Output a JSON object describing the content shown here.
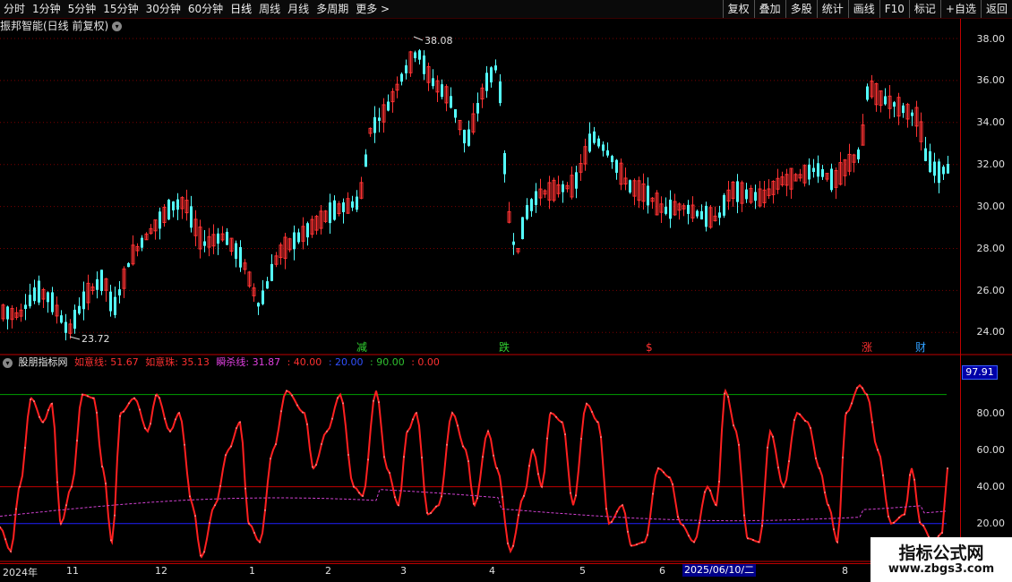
{
  "toolbar": {
    "left": [
      "分时",
      "1分钟",
      "5分钟",
      "15分钟",
      "30分钟",
      "60分钟",
      "日线",
      "周线",
      "月线",
      "多周期",
      "更多 >"
    ],
    "right": [
      "复权",
      "叠加",
      "多股",
      "统计",
      "画线",
      "F10",
      "标记",
      "+自选",
      "返回"
    ]
  },
  "chart_title": "振邦智能(日线 前复权)",
  "price_axis": [
    "38.00",
    "36.00",
    "34.00",
    "32.00",
    "30.00",
    "28.00",
    "26.00",
    "24.00"
  ],
  "high_label": "38.08",
  "low_label": "23.72",
  "markers": [
    "减",
    "跌",
    "$",
    "涨",
    "财"
  ],
  "indicator": {
    "name": "股朋指标网",
    "items": [
      {
        "text": "如意线: 51.67",
        "color": "#ff3030"
      },
      {
        "text": "如意珠: 35.13",
        "color": "#ff3030"
      },
      {
        "text": "瞬杀线: 31.87",
        "color": "#e040e0"
      },
      {
        "text": ": 40.00",
        "color": "#ff3030"
      },
      {
        "text": ": 20.00",
        "color": "#3050ff"
      },
      {
        "text": ": 90.00",
        "color": "#30c030"
      },
      {
        "text": ": 0.00",
        "color": "#ff3030"
      }
    ],
    "current_value": "97.91",
    "axis": [
      "80.00",
      "60.00",
      "40.00",
      "20.00"
    ]
  },
  "date_axis": [
    "2024年",
    "11",
    "12",
    "1",
    "2",
    "3",
    "4",
    "5",
    "6",
    "8"
  ],
  "date_tip": "2025/06/10/二",
  "watermark": {
    "title": "指标公式网",
    "url": "www.zbgs3.com"
  },
  "colors": {
    "up": "#ff3232",
    "down": "#54ffff",
    "line": "#ff2020",
    "ref40": "#c00000",
    "ref20": "#2020ff",
    "ref90": "#00a000",
    "dash": "#d040d0"
  }
}
